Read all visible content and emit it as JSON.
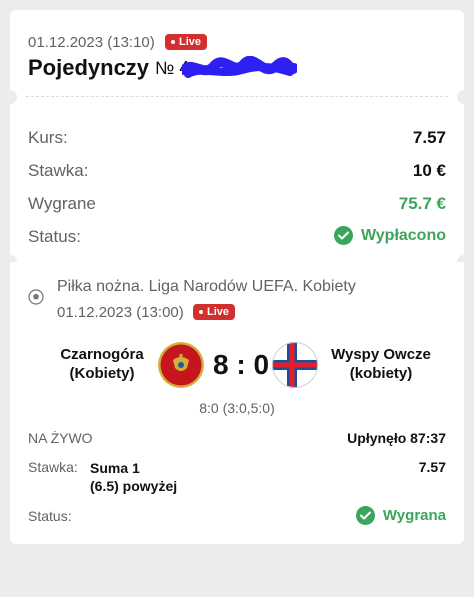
{
  "bet": {
    "datetime": "01.12.2023 (13:10)",
    "live_label": "Live",
    "type": "Pojedynczy",
    "number_prefix": "№ 4",
    "rows": {
      "odds_label": "Kurs:",
      "odds_value": "7.57",
      "stake_label": "Stawka:",
      "stake_value": "10 €",
      "win_label": "Wygrane",
      "win_value": "75.7 €",
      "status_label": "Status:",
      "status_value": "Wypłacono"
    }
  },
  "event": {
    "league": "Piłka nożna. Liga Narodów UEFA. Kobiety",
    "datetime": "01.12.2023 (13:00)",
    "live_label": "Live",
    "home_team": "Czarnogóra (Kobiety)",
    "away_team": "Wyspy Owcze (kobiety)",
    "score": "8 : 0",
    "score_detail": "8:0 (3:0,5:0)",
    "live_status": "NA ŻYWO",
    "elapsed": "Upłynęło 87:37",
    "stake_label": "Stawka:",
    "selection_line1": "Suma 1",
    "selection_line2": "(6.5) powyżej",
    "selection_odds": "7.57",
    "status_label": "Status:",
    "status_value": "Wygrana"
  },
  "colors": {
    "green": "#3aa65b",
    "live_red": "#d32f2f",
    "redaction_blue": "#2e20f0"
  },
  "icons": [
    "live-dot-icon",
    "check-circle-icon",
    "football-icon",
    "montenegro-flag-icon",
    "faroe-islands-flag-icon"
  ]
}
